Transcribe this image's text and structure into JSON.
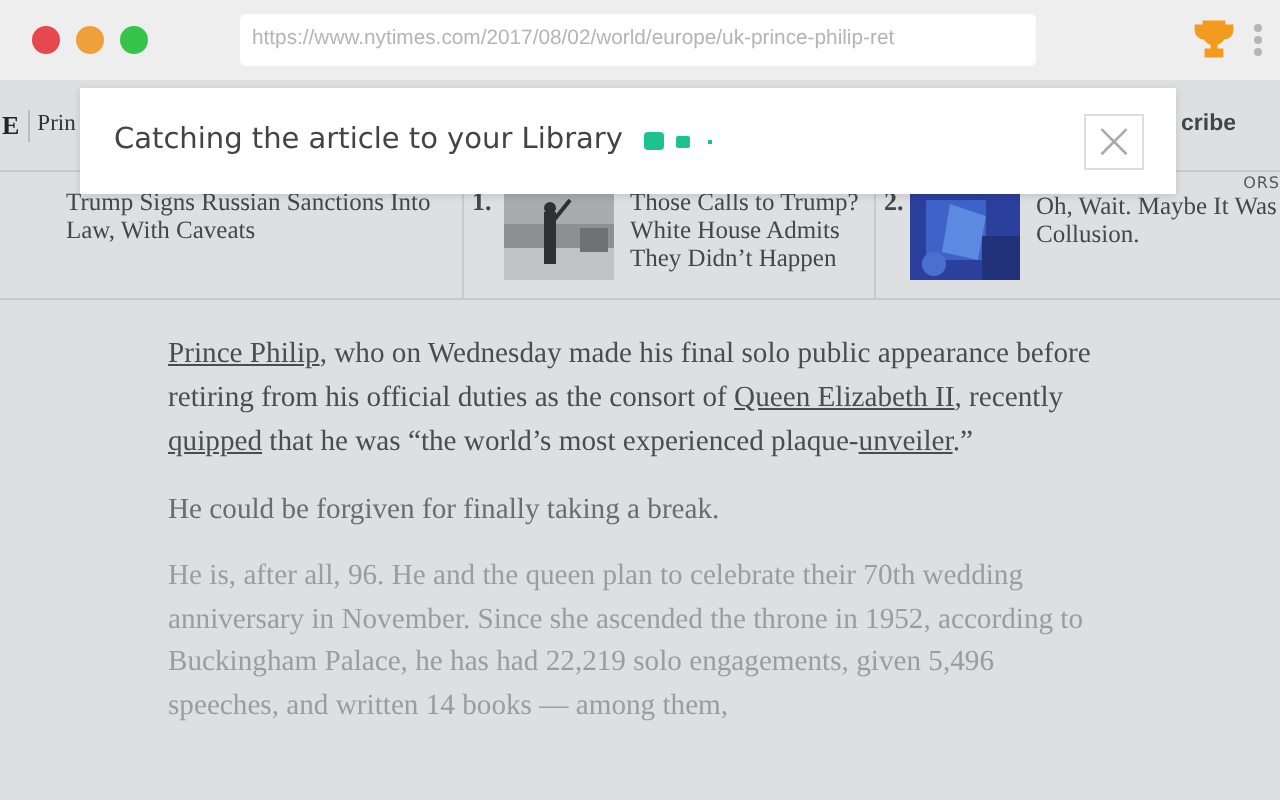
{
  "browser": {
    "url": "https://www.nytimes.com/2017/08/02/world/europe/uk-prince-philip-ret"
  },
  "nav": {
    "logo_fragment": "E",
    "section_fragment": "Prin",
    "subscribe_fragment": "cribe"
  },
  "popup": {
    "message": "Catching the article to your Library",
    "close": "×"
  },
  "trending": [
    {
      "headline": "Trump Signs Russian Sanctions Into Law, With Caveats",
      "thumbnail": false
    },
    {
      "number": "1.",
      "headline": "Those Calls to Trump? White House Admits They Didn’t Happen",
      "thumbnail": true
    },
    {
      "number": "2.",
      "kicker": "ORS",
      "headline": "Oh, Wait. Maybe It Was Collusion.",
      "thumbnail": true
    }
  ],
  "article": [
    [
      {
        "text": "Prince Philip",
        "link": true
      },
      {
        "text": ", who on Wednesday made his final solo public appearance before retiring from his official duties as the consort of "
      },
      {
        "text": "Queen Elizabeth II",
        "link": true
      },
      {
        "text": ", recently "
      },
      {
        "text": "quipped",
        "link": true
      },
      {
        "text": " that he was “the world’s most experienced plaque-"
      },
      {
        "text": "unveiler",
        "link": true
      },
      {
        "text": ".”"
      }
    ],
    [
      {
        "text": "He could be forgiven for finally taking a break."
      }
    ],
    [
      {
        "text": "He is, after all, 96. He and the queen plan to celebrate their 70th wedding anniversary in November. Since she ascended the throne in 1952, according to Buckingham Palace, he has had 22,219 solo engagements, given 5,496 speeches, and written 14 books — among them,"
      }
    ]
  ]
}
